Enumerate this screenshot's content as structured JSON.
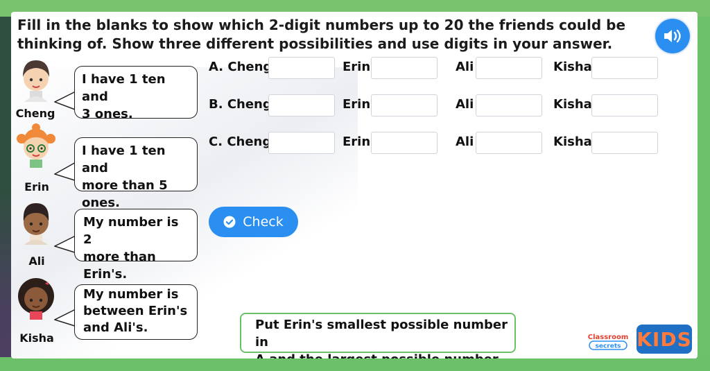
{
  "question": "Fill in the blanks to show which 2-digit numbers up to 20 the friends could be thinking of. Show three different possibilities and use digits in your answer.",
  "audio_icon": "speaker-icon",
  "characters": [
    {
      "name": "Cheng",
      "speech_1": "I have 1 ten and",
      "speech_2": "3 ones."
    },
    {
      "name": "Erin",
      "speech_1": "I have 1 ten and",
      "speech_2": "more than 5 ones."
    },
    {
      "name": "Ali",
      "speech_1": "My number is 2",
      "speech_2": "more than Erin's."
    },
    {
      "name": "Kisha",
      "speech_1": "My number is",
      "speech_2": "between Erin's",
      "speech_3": "and Ali's."
    }
  ],
  "rows": [
    {
      "label": "A. Cheng",
      "erin": "Erin",
      "ali": "Ali",
      "kisha": "Kisha",
      "values": [
        "",
        "",
        "",
        ""
      ]
    },
    {
      "label": "B. Cheng",
      "erin": "Erin",
      "ali": "Ali",
      "kisha": "Kisha",
      "values": [
        "",
        "",
        "",
        ""
      ]
    },
    {
      "label": "C. Cheng",
      "erin": "Erin",
      "ali": "Ali",
      "kisha": "Kisha",
      "values": [
        "",
        "",
        "",
        ""
      ]
    }
  ],
  "check_button": "Check",
  "hint_line_1": "Put Erin's smallest possible number in",
  "hint_line_2": "A and the largest possible number in C.",
  "logo": {
    "line_1": "Classroom",
    "line_2": "secrets",
    "kids": "KIDS"
  },
  "colors": {
    "accent": "#2a8ff0",
    "green": "#6cc06a"
  }
}
